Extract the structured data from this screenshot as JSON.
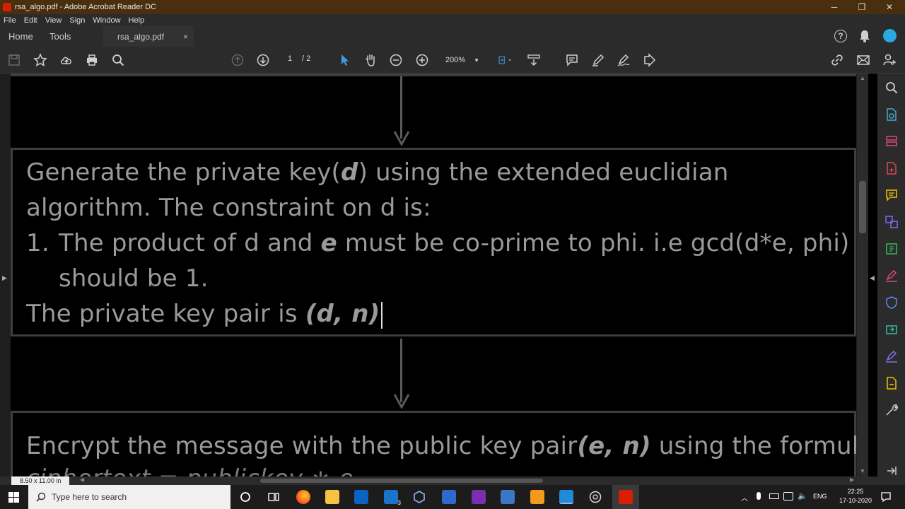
{
  "window": {
    "title": "rsa_algo.pdf - Adobe Acrobat Reader DC",
    "minimize": "─",
    "maximize": "❐",
    "close": "✕"
  },
  "menu": [
    "File",
    "Edit",
    "View",
    "Sign",
    "Window",
    "Help"
  ],
  "tabs": {
    "home": "Home",
    "tools": "Tools",
    "document": "rsa_algo.pdf",
    "close": "×"
  },
  "toolbar": {
    "current_page": "1",
    "page_total": "/ 2",
    "zoom": "200%"
  },
  "document": {
    "box1": {
      "line1_pre": "Generate the private key(",
      "line1_em": "d",
      "line1_post": ")  using the extended euclidian",
      "line2": "algorithm. The constraint on d is:",
      "item_number": "1.",
      "item_pre": "The product of d and ",
      "item_em": "e",
      "item_post": " must be co-prime to phi. i.e gcd(d*e, phi)",
      "item_line2": "should be 1.",
      "footer_pre": "The private key pair is ",
      "footer_em": "(d, n)"
    },
    "box2": {
      "line1_pre": "Encrypt the message with the public key pair",
      "line1_em": "(e, n)",
      "line1_post": " using the formula:",
      "line2_partial": "ciphertext = publickey ∗ e"
    }
  },
  "status": {
    "page_size": "8.50 x 11.00 in"
  },
  "taskbar": {
    "search_placeholder": "Type here to search",
    "language": "ENG",
    "time": "22:25",
    "date": "17-10-2020",
    "mail_badge": "3"
  },
  "colors": {
    "titlebar": "#4a2f0f",
    "chrome": "#2b2b2b",
    "slide_text": "#9a9a9a",
    "accent_blue": "#2aa9e0",
    "acrobat_red": "#d81e05"
  }
}
